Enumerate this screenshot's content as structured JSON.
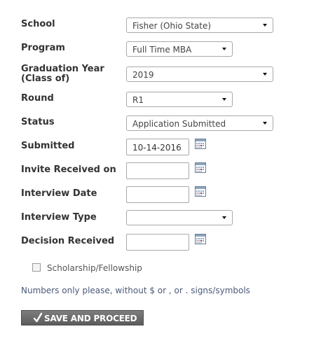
{
  "form": {
    "school": {
      "label": "School",
      "value": "Fisher (Ohio State)"
    },
    "program": {
      "label": "Program",
      "value": "Full Time MBA"
    },
    "graduation_year": {
      "label_line1": "Graduation Year",
      "label_line2": "(Class of)",
      "value": "2019"
    },
    "round": {
      "label": "Round",
      "value": "R1"
    },
    "status": {
      "label": "Status",
      "value": "Application Submitted"
    },
    "submitted": {
      "label": "Submitted",
      "value": "10-14-2016"
    },
    "invite_received": {
      "label": "Invite Received on",
      "value": ""
    },
    "interview_date": {
      "label": "Interview Date",
      "value": ""
    },
    "interview_type": {
      "label": "Interview Type",
      "value": ""
    },
    "decision_received": {
      "label": "Decision Received",
      "value": ""
    },
    "scholarship": {
      "label": "Scholarship/Fellowship",
      "checked": false
    },
    "note": "Numbers only please, without $ or , or . signs/symbols",
    "save_label": "SAVE AND PROCEED"
  },
  "icons": {
    "calendar": "calendar-icon",
    "dropdown": "chevron-down-icon",
    "check": "check-icon"
  },
  "colors": {
    "button_bg": "#6b6b6b",
    "note_text": "#4a5a78",
    "calendar_accent": "#b0243a"
  }
}
